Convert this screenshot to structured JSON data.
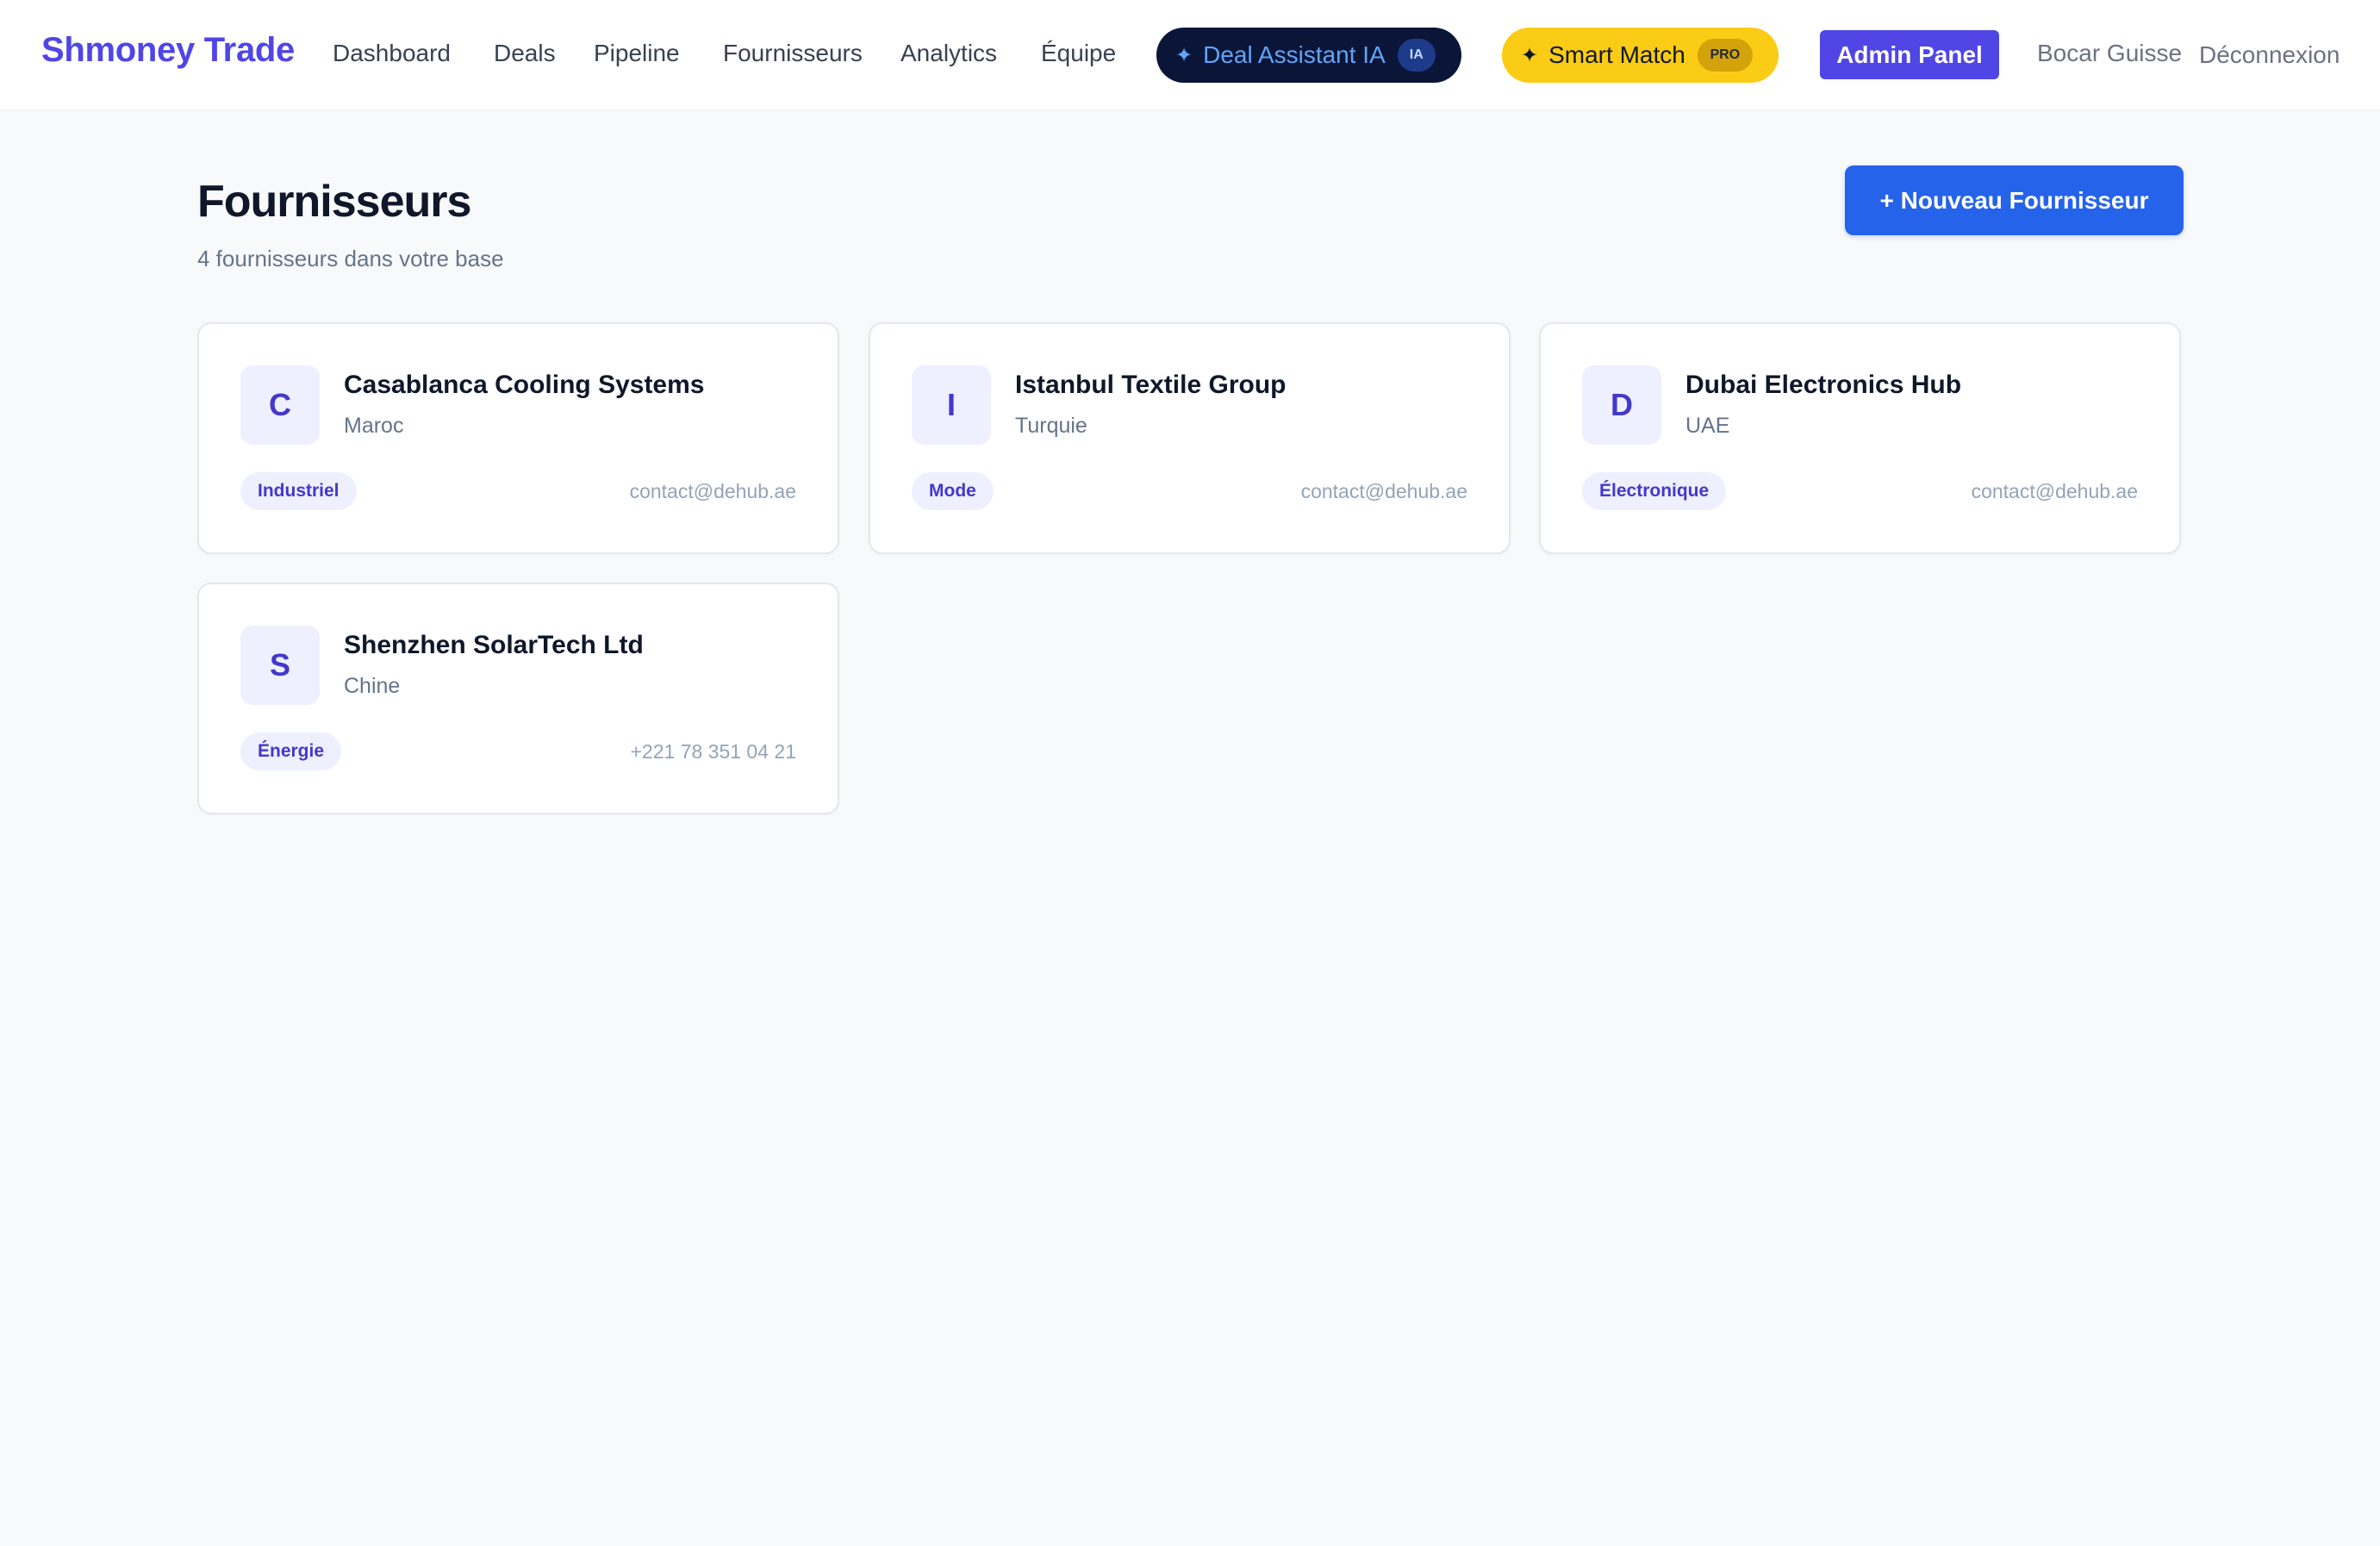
{
  "nav": {
    "brand": "Shmoney Trade",
    "links": [
      "Dashboard",
      "Deals",
      "Pipeline",
      "Fournisseurs",
      "Analytics",
      "Équipe"
    ],
    "ai_button": {
      "icon": "sparkle-icon",
      "label": "Deal Assistant IA",
      "tag": "IA"
    },
    "match_button": {
      "icon": "sparkle-icon",
      "label": "Smart Match",
      "tag": "PRO"
    },
    "admin_label": "Admin Panel",
    "user_name": "Bocar Guisse",
    "logout_label": "Déconnexion"
  },
  "header": {
    "title": "Fournisseurs",
    "subtitle": "4 fournisseurs dans votre base",
    "new_button_label": "+ Nouveau Fournisseur"
  },
  "suppliers": [
    {
      "initial": "C",
      "name": "Casablanca Cooling Systems",
      "country": "Maroc",
      "category": "Industriel",
      "contact": "contact@dehub.ae"
    },
    {
      "initial": "I",
      "name": "Istanbul Textile Group",
      "country": "Turquie",
      "category": "Mode",
      "contact": "contact@dehub.ae"
    },
    {
      "initial": "D",
      "name": "Dubai Electronics Hub",
      "country": "UAE",
      "category": "Électronique",
      "contact": "contact@dehub.ae"
    },
    {
      "initial": "S",
      "name": "Shenzhen SolarTech Ltd",
      "country": "Chine",
      "category": "Énergie",
      "contact": "+221 78 351 04 21"
    }
  ],
  "colors": {
    "brand": "#4f46e5",
    "primary_button": "#2563eb",
    "ai_pill_bg": "#0b1538",
    "ai_pill_text": "#60a5fa",
    "match_pill_bg": "#facc15",
    "page_bg": "#f8f9fb",
    "badge_bg": "#eef0ff",
    "badge_text": "#4338ca"
  }
}
